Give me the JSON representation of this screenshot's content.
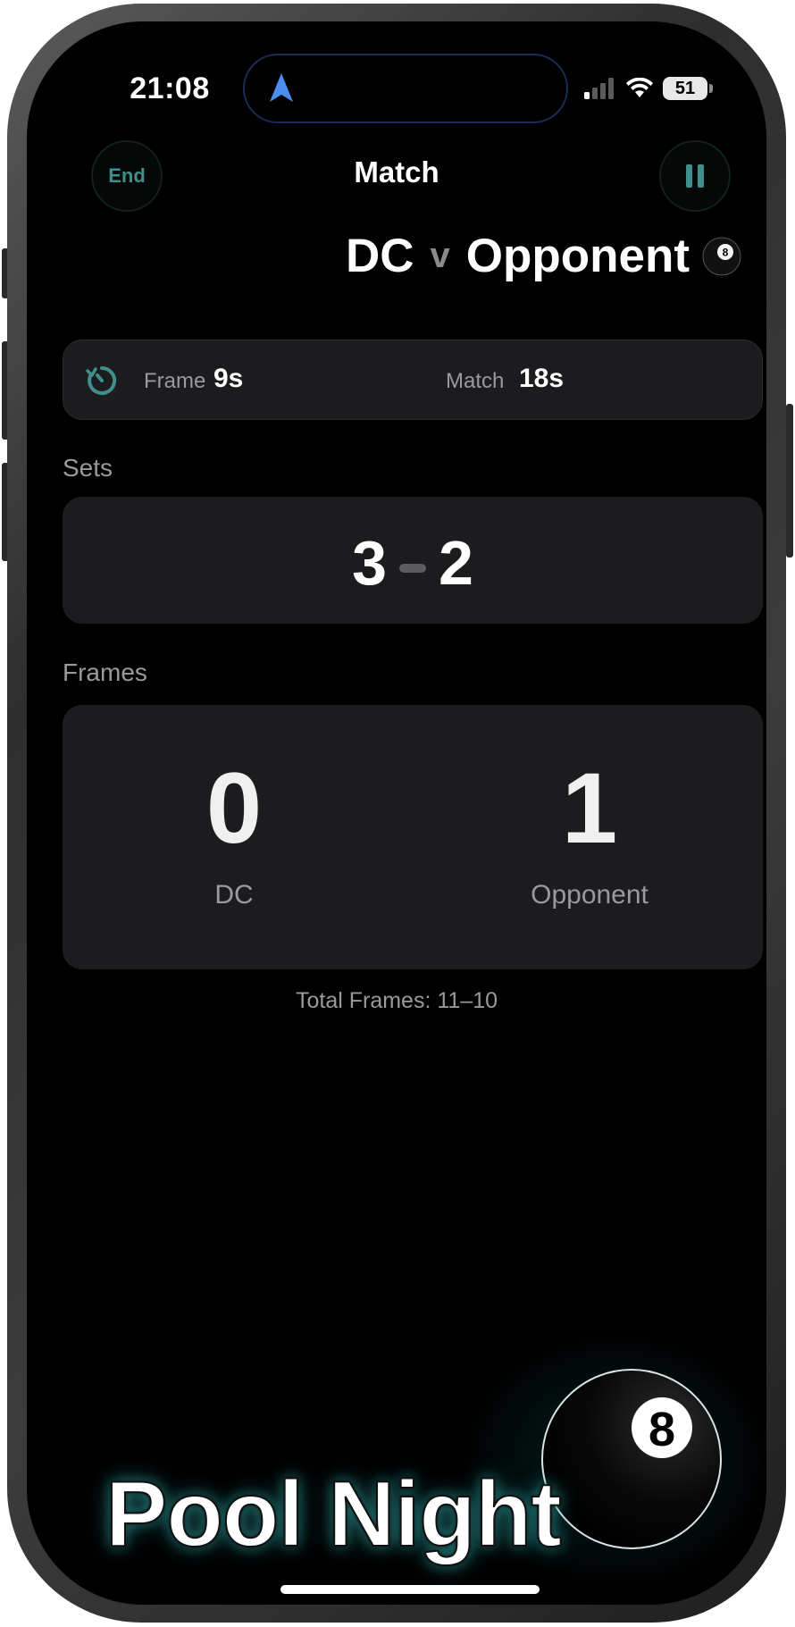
{
  "status_bar": {
    "time": "21:08",
    "battery": "51"
  },
  "nav": {
    "end_label": "End",
    "title": "Match"
  },
  "matchup": {
    "player": "DC",
    "vs": "v",
    "opponent": "Opponent"
  },
  "timer": {
    "frame_label": "Frame",
    "frame_value": "9s",
    "match_label": "Match",
    "match_value": "18s"
  },
  "sets": {
    "label": "Sets",
    "player_score": "3",
    "opponent_score": "2"
  },
  "frames": {
    "label": "Frames",
    "player_score": "0",
    "player_name": "DC",
    "opponent_score": "1",
    "opponent_name": "Opponent",
    "total": "Total Frames: 11–10"
  },
  "logo": {
    "text": "Pool Night",
    "ball_number": "8"
  },
  "colors": {
    "accent": "#3f8f8c",
    "background": "#000000",
    "card": "#1c1c1e",
    "secondary_text": "#9a9a9e"
  }
}
